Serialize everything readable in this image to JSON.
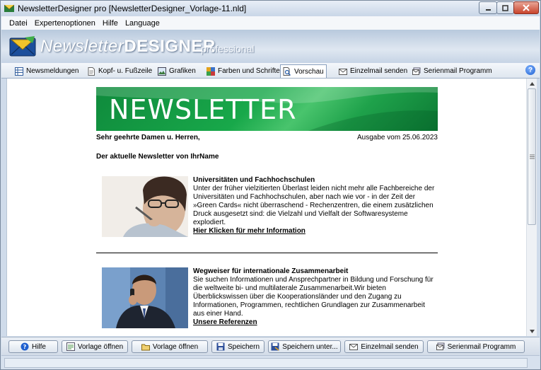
{
  "window": {
    "title": "NewsletterDesigner pro [NewsletterDesigner_Vorlage-11.nld]"
  },
  "menu": [
    "Datei",
    "Expertenoptionen",
    "Hilfe",
    "Language"
  ],
  "banner": {
    "brand_light": "Newsletter",
    "brand_bold": "DESIGNER",
    "edition": "professional"
  },
  "tabs": [
    {
      "label": "Newsmeldungen",
      "icon": "table-icon"
    },
    {
      "label": "Kopf- u. Fußzeile",
      "icon": "document-icon"
    },
    {
      "label": "Grafiken",
      "icon": "image-icon"
    },
    {
      "label": "Farben und Schriften",
      "icon": "palette-icon"
    },
    {
      "label": "Vorschau",
      "icon": "magnifier-icon",
      "active": true
    },
    {
      "label": "Einzelmail senden",
      "icon": "mail-icon"
    },
    {
      "label": "Serienmail Programm",
      "icon": "mail-stack-icon"
    }
  ],
  "newsletter": {
    "header_title": "NEWSLETTER",
    "greeting": "Sehr geehrte Damen u. Herren,",
    "issue": "Ausgabe vom 25.06.2023",
    "intro": "Der aktuelle Newsletter von IhrName",
    "articles": [
      {
        "heading": "Universitäten und Fachhochschulen",
        "body": "Unter der früher vielzitierten Überlast leiden nicht mehr alle Fachbereiche der Universitäten und Fachhochschulen, aber nach wie vor - in der Zeit der »Green Cards« nicht überraschend - Rechenzentren, die einem zusätzlichen Druck ausgesetzt sind: die Vielzahl und Vielfalt der Softwaresysteme explodiert.",
        "link": "Hier Klicken für mehr Information"
      },
      {
        "heading": "Wegweiser für internationale Zusammenarbeit",
        "body": "Sie suchen Informationen und Ansprechpartner in Bildung und Forschung für die weltweite bi- und multilaterale Zusammenarbeit.Wir bieten Überblickswissen über die Kooperationsländer und den Zugang zu Informationen, Programmen, rechtlichen Grundlagen zur Zusammenarbeit aus einer Hand.",
        "link": "Unsere Referenzen"
      }
    ]
  },
  "bottom_buttons": [
    {
      "label": "Hilfe",
      "icon": "help-icon"
    },
    {
      "label": "Vorlage öffnen",
      "icon": "open-template-icon"
    },
    {
      "label": "Vorlage öffnen",
      "icon": "open-folder-icon"
    },
    {
      "label": "Speichern",
      "icon": "save-icon"
    },
    {
      "label": "Speichern unter...",
      "icon": "save-as-icon"
    },
    {
      "label": "Einzelmail senden",
      "icon": "mail-icon"
    },
    {
      "label": "Serienmail Programm",
      "icon": "mail-stack-icon"
    }
  ],
  "colors": {
    "accent_green": "#18a84a",
    "window_blue": "#cfdbea"
  }
}
